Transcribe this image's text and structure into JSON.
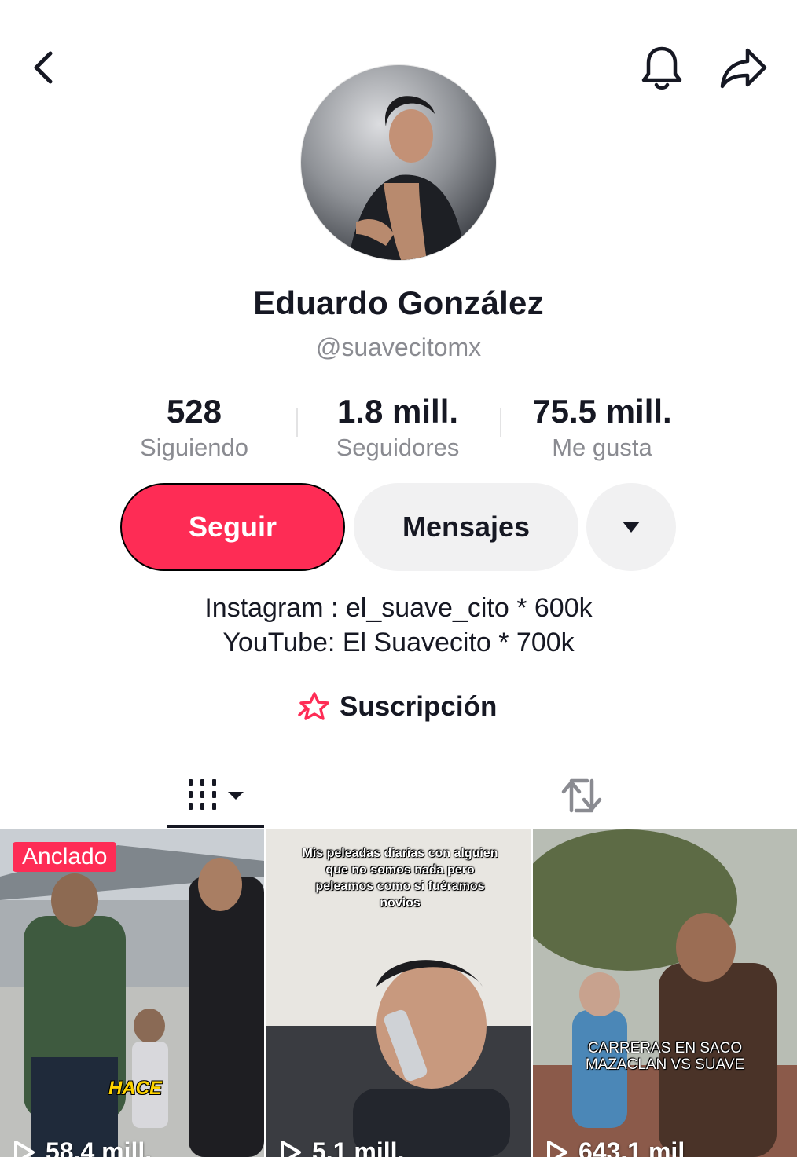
{
  "header": {
    "back_icon": "chevron-left-icon",
    "bell_icon": "bell-icon",
    "share_icon": "share-arrow-icon"
  },
  "profile": {
    "display_name": "Eduardo González",
    "username": "@suavecitomx"
  },
  "stats": [
    {
      "value": "528",
      "label": "Siguiendo"
    },
    {
      "value": "1.8 mill.",
      "label": "Seguidores"
    },
    {
      "value": "75.5 mill.",
      "label": "Me gusta"
    }
  ],
  "actions": {
    "follow_label": "Seguir",
    "message_label": "Mensajes",
    "more_icon": "caret-down-icon"
  },
  "bio": {
    "line1": "Instagram : el_suave_cito * 600k",
    "line2": "YouTube: El Suavecito * 700k"
  },
  "subscription": {
    "label": "Suscripción",
    "icon": "star-badge-icon"
  },
  "tabs": {
    "videos_icon": "grid-sort-icon",
    "reposts_icon": "repost-icon"
  },
  "videos": [
    {
      "pinned_label": "Anclado",
      "overlay_text": "HACE",
      "views": "58.4 mill."
    },
    {
      "caption": "Mis peleadas diarias con alguien que no somos nada pero peleamos como si fuéramos novios",
      "views": "5.1 mill."
    },
    {
      "caption_line1": "CARRERAS EN SACO",
      "caption_line2": "MAZACLAN VS SUAVE",
      "views": "643.1 mil"
    }
  ],
  "colors": {
    "accent": "#fe2c55",
    "text_primary": "#161823",
    "text_secondary": "#8a8b91",
    "button_secondary": "#f1f1f2"
  }
}
